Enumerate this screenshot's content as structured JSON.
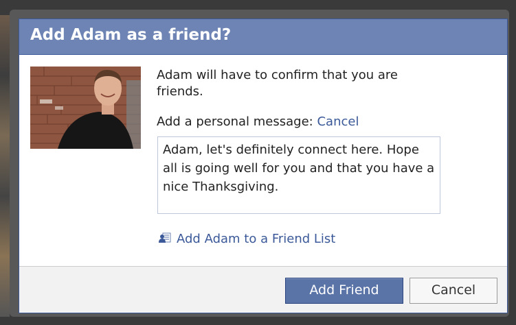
{
  "dialog": {
    "title": "Add Adam as a friend?",
    "confirm_text": "Adam will have to confirm that you are friends.",
    "message_label": "Add a personal message:",
    "message_cancel_link": "Cancel",
    "message_value": "Adam, let's definitely connect here. Hope all is going well for you and that you have a nice Thanksgiving.",
    "friend_list_link": "Add Adam to a Friend List",
    "add_friend_button": "Add Friend",
    "cancel_button": "Cancel"
  },
  "icons": {
    "friend_list": "friend-list-icon"
  },
  "colors": {
    "title_bar": "#6d84b4",
    "link": "#3b5998",
    "primary_button": "#5b74a8"
  }
}
